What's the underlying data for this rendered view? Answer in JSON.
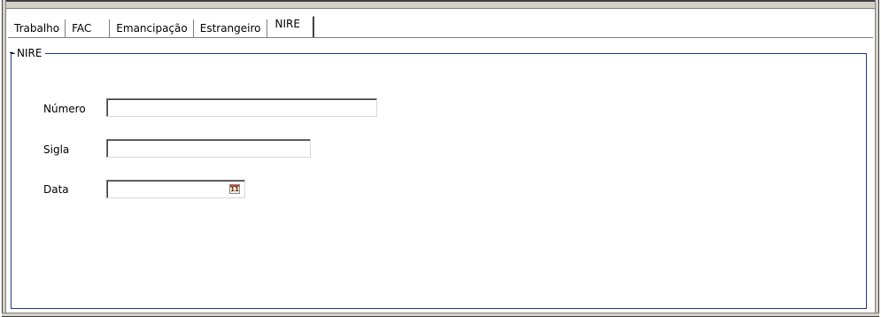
{
  "tabs": [
    "Trabalho",
    "FAC",
    "Emancipação",
    "Estrangeiro",
    "NIRE"
  ],
  "active_tab": "NIRE",
  "group": {
    "title": "NIRE",
    "fields": {
      "numero": {
        "label": "Número",
        "value": ""
      },
      "sigla": {
        "label": "Sigla",
        "value": ""
      },
      "data": {
        "label": "Data",
        "value": ""
      }
    }
  },
  "calendar_icon_text": "11",
  "colors": {
    "group_border": "#203880",
    "frame": "#808080"
  }
}
